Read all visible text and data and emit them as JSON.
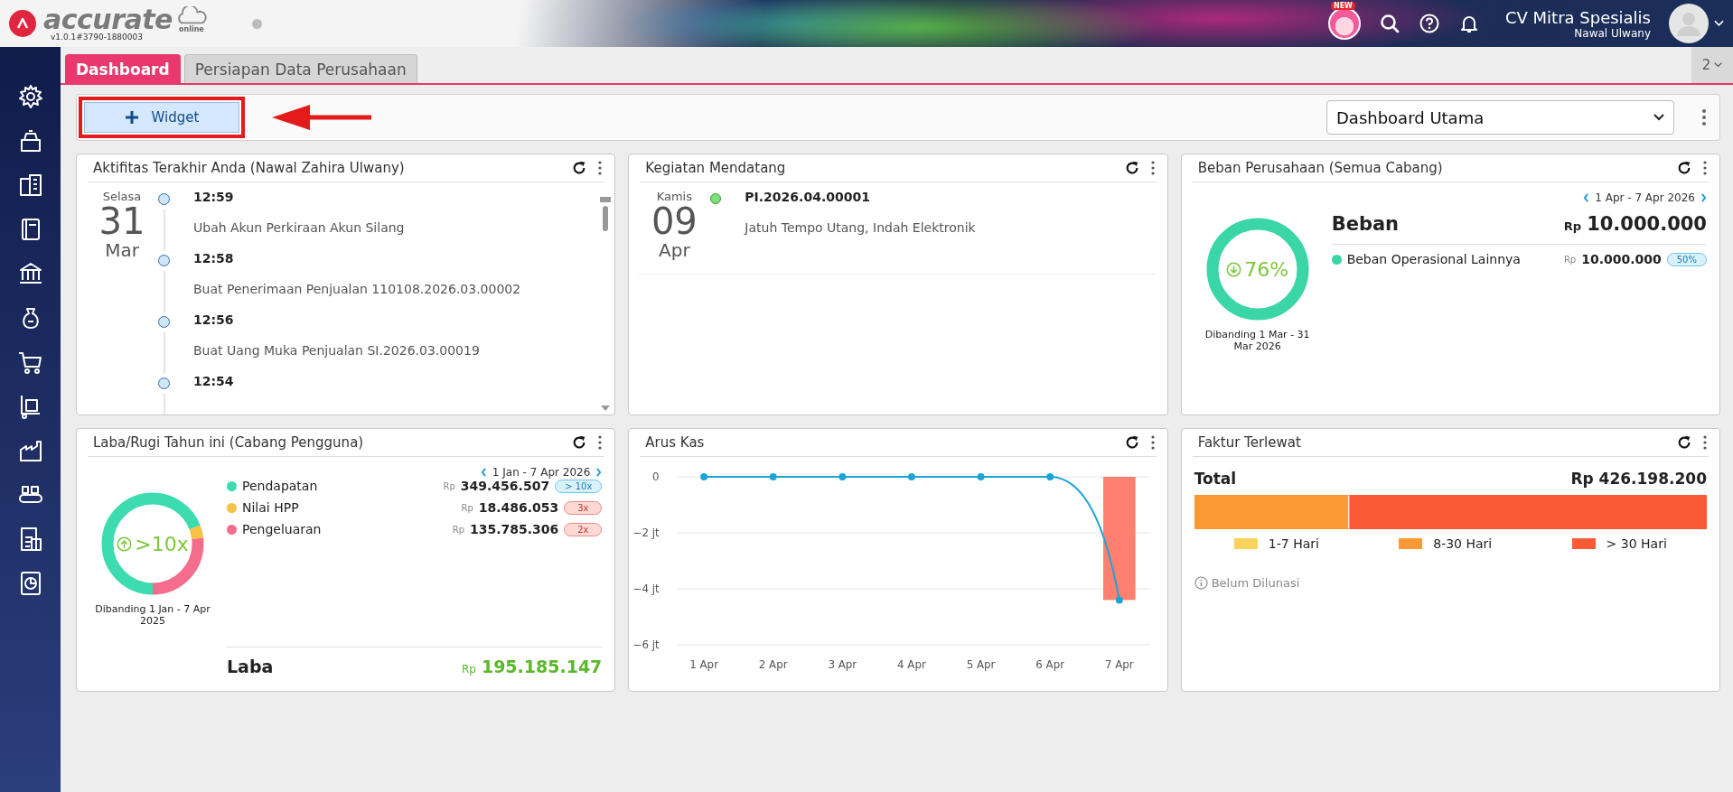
{
  "header": {
    "logo_text": "accurate",
    "logo_sub": "online",
    "version": "v1.0.1#3790-1880003",
    "new_badge": "NEW",
    "company": "CV Mitra Spesialis",
    "user": "Nawal Ulwany"
  },
  "tabs": [
    {
      "label": "Dashboard",
      "selected": true
    },
    {
      "label": "Persiapan Data Perusahaan",
      "selected": false
    }
  ],
  "tab_count": "2",
  "toolbar": {
    "add_button": "Widget",
    "dashboard_select": "Dashboard Utama"
  },
  "activity": {
    "title": "Aktifitas Terakhir Anda (Nawal Zahira Ulwany)",
    "day": "Selasa",
    "date": "31",
    "month": "Mar",
    "items": [
      {
        "time": "12:59",
        "text": "Ubah Akun Perkiraan Akun Silang"
      },
      {
        "time": "12:58",
        "text": "Buat Penerimaan Penjualan 110108.2026.03.00002"
      },
      {
        "time": "12:56",
        "text": "Buat Uang Muka Penjualan SI.2026.03.00019"
      },
      {
        "time": "12:54"
      }
    ]
  },
  "upcoming": {
    "title": "Kegiatan Mendatang",
    "day": "Kamis",
    "date": "09",
    "month": "Apr",
    "items": [
      {
        "code": "PI.2026.04.00001",
        "text": "Jatuh Tempo Utang, Indah Elektronik",
        "color": "#7ee07a"
      }
    ]
  },
  "expense": {
    "title": "Beban Perusahaan (Semua Cabang)",
    "period": "1 Apr - 7 Apr 2026",
    "change": "76%",
    "increase": false,
    "compare": "Dibanding 1 Mar - 31 Mar 2026",
    "total_label": "Beban",
    "currency": "Rp",
    "total": "10.000.000",
    "items": [
      {
        "name": "Beban Operasional Lainnya",
        "currency": "Rp",
        "amount": "10.000.000",
        "badge": "50%",
        "warning": false,
        "color": "#3ad6a8"
      }
    ]
  },
  "profit": {
    "title": "Laba/Rugi Tahun ini (Cabang Pengguna)",
    "period": "1 Jan - 7 Apr 2026",
    "change": ">10x",
    "increase": true,
    "compare": "Dibanding 1 Jan - 7 Apr 2025",
    "items": [
      {
        "name": "Pendapatan",
        "currency": "Rp",
        "amount": "349.456.507",
        "badge": "> 10x",
        "warning": false,
        "color": "#3ddbb0"
      },
      {
        "name": "Nilai HPP",
        "currency": "Rp",
        "amount": "18.486.053",
        "badge": "3x",
        "warning": true,
        "color": "#f5c242"
      },
      {
        "name": "Pengeluaran",
        "currency": "Rp",
        "amount": "135.785.306",
        "badge": "2x",
        "warning": true,
        "color": "#f56d8c"
      }
    ],
    "result_label": "Laba",
    "result_currency": "Rp",
    "result": "195.185.147"
  },
  "cashflow": {
    "title": "Arus Kas",
    "chart_data": {
      "type": "line",
      "categories": [
        "1 Apr",
        "2 Apr",
        "3 Apr",
        "4 Apr",
        "5 Apr",
        "6 Apr",
        "7 Apr"
      ],
      "ylim": [
        -6,
        0
      ],
      "yticks": [
        {
          "value": 0,
          "label": "0"
        },
        {
          "value": -2,
          "label": "−2 jt"
        },
        {
          "value": -4,
          "label": "−4 jt"
        },
        {
          "value": -6,
          "label": "−6 jt"
        }
      ],
      "series": [
        {
          "marker": "o",
          "color": "#1ba3d6",
          "values": [
            0,
            0,
            0,
            0,
            0,
            0,
            -4.4
          ]
        },
        {
          "type": "bar",
          "color": "#ff8070",
          "values": [
            null,
            null,
            null,
            null,
            null,
            null,
            -4.4
          ]
        }
      ]
    }
  },
  "overdue": {
    "title": "Faktur Terlewat",
    "total_label": "Total",
    "total": "Rp 426.198.200",
    "buckets": [
      {
        "label": "1-7 Hari",
        "color": "#f9d35c"
      },
      {
        "label": "8-30 Hari",
        "color": "#fb9a35"
      },
      {
        "label": "> 30 Hari",
        "color": "#fb5a36"
      }
    ],
    "note": "Belum Dilunasi"
  }
}
